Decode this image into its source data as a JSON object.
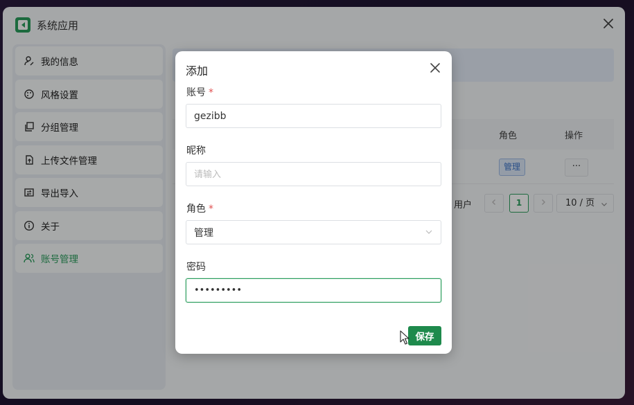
{
  "window": {
    "title": "系统应用"
  },
  "sidebar": {
    "items": [
      {
        "label": "我的信息",
        "icon": "user-edit-icon"
      },
      {
        "label": "风格设置",
        "icon": "palette-icon"
      },
      {
        "label": "分组管理",
        "icon": "group-copy-icon"
      },
      {
        "label": "上传文件管理",
        "icon": "file-upload-icon"
      },
      {
        "label": "导出导入",
        "icon": "swap-icon"
      },
      {
        "label": "关于",
        "icon": "info-icon"
      },
      {
        "label": "账号管理",
        "icon": "users-icon",
        "active": true
      }
    ]
  },
  "table": {
    "headers": {
      "role": "角色",
      "actions": "操作"
    },
    "row": {
      "role": "管理",
      "actions_label": "···"
    }
  },
  "pagination": {
    "total_suffix": "用户",
    "current_page": "1",
    "page_size": "10 / 页"
  },
  "dialog": {
    "title": "添加",
    "account": {
      "label": "账号",
      "required_mark": "*",
      "value": "gezibb"
    },
    "nickname": {
      "label": "昵称",
      "placeholder": "请输入",
      "value": ""
    },
    "role": {
      "label": "角色",
      "required_mark": "*",
      "value": "管理"
    },
    "password": {
      "label": "密码",
      "value": "•••••••••"
    },
    "save_label": "保存"
  },
  "colors": {
    "accent": "#2a9d5c",
    "save": "#1e8a4c",
    "required": "#e05050"
  }
}
